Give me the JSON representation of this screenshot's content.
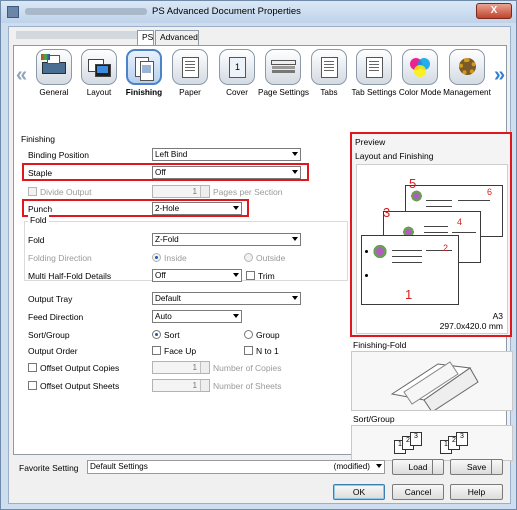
{
  "window": {
    "title": "PS Advanced Document Properties",
    "close_label": "X"
  },
  "tabs": [
    {
      "label": "PS"
    },
    {
      "label": "Advanced"
    }
  ],
  "categories": [
    {
      "label": "General",
      "icon": "printer-icon"
    },
    {
      "label": "Layout",
      "icon": "layout-icon"
    },
    {
      "label": "Finishing",
      "icon": "finishing-icon"
    },
    {
      "label": "Paper",
      "icon": "paper-icon"
    },
    {
      "label": "Cover",
      "icon": "cover-icon"
    },
    {
      "label": "Page Settings",
      "icon": "page-settings-icon"
    },
    {
      "label": "Tabs",
      "icon": "tabs-icon"
    },
    {
      "label": "Tab Settings",
      "icon": "tab-settings-icon"
    },
    {
      "label": "Color Mode",
      "icon": "color-mode-icon"
    },
    {
      "label": "Management",
      "icon": "management-icon"
    }
  ],
  "scroll": {
    "left": "«",
    "right": "»"
  },
  "finishing": {
    "section_title": "Finishing",
    "binding_position": {
      "label": "Binding Position",
      "value": "Left Bind"
    },
    "staple": {
      "label": "Staple",
      "value": "Off"
    },
    "divide_output": {
      "label": "Divide Output",
      "value": "1",
      "unit": "Pages per Section"
    },
    "punch": {
      "label": "Punch",
      "value": "2-Hole"
    },
    "fold_group": "Fold",
    "fold": {
      "label": "Fold",
      "value": "Z-Fold"
    },
    "folding_direction": {
      "label": "Folding Direction",
      "inside": "Inside",
      "outside": "Outside"
    },
    "multi_half_fold": {
      "label": "Multi Half-Fold Details",
      "value": "Off",
      "trim": "Trim"
    },
    "output_tray": {
      "label": "Output Tray",
      "value": "Default"
    },
    "feed_direction": {
      "label": "Feed Direction",
      "value": "Auto"
    },
    "sort_group": {
      "label": "Sort/Group",
      "sort": "Sort",
      "group": "Group"
    },
    "output_order": {
      "label": "Output Order",
      "face_up": "Face Up",
      "n_to_1": "N to 1"
    },
    "offset_output_copies": {
      "label": "Offset Output Copies",
      "value": "1",
      "unit": "Number of Copies"
    },
    "offset_output_sheets": {
      "label": "Offset Output Sheets",
      "value": "1",
      "unit": "Number of Sheets"
    }
  },
  "preview": {
    "group_title": "Preview",
    "layout_title": "Layout and Finishing",
    "page_numbers": [
      "5",
      "6",
      "3",
      "4",
      "1",
      "2"
    ],
    "paper_size": "A3",
    "paper_dims": "297.0x420.0 mm",
    "finishing_fold_title": "Finishing-Fold",
    "sort_group_title": "Sort/Group",
    "stack_numbers": [
      "1",
      "2",
      "3"
    ]
  },
  "footer": {
    "favorite_label": "Favorite Setting",
    "favorite_value": "Default Settings",
    "modified": "(modified)",
    "load": "Load",
    "save": "Save",
    "ok": "OK",
    "cancel": "Cancel",
    "help": "Help"
  },
  "colors": {
    "highlight": "#e0171c",
    "accent": "#2f7fd2",
    "window_frame": "#cfdeee"
  }
}
